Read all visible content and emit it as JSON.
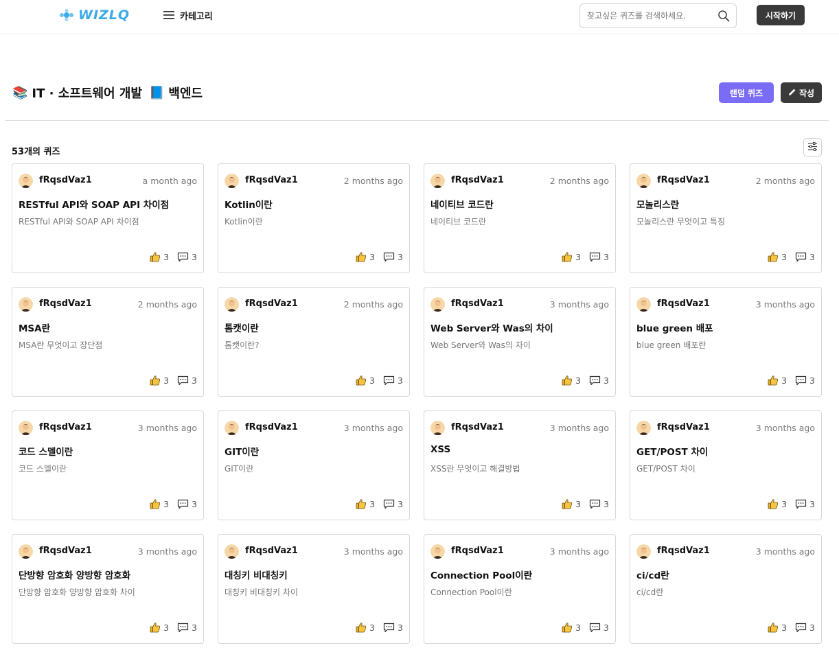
{
  "header": {
    "logo_text": "WIZLQ",
    "category_label": "카테고리",
    "search_placeholder": "찾고싶은 퀴즈를 검색하세요.",
    "start_label": "시작하기"
  },
  "page": {
    "category_emoji": "📚",
    "category": "IT · 소프트웨어 개발",
    "subcategory_emoji": "📘",
    "subcategory": "백엔드",
    "random_label": "랜덤 퀴즈",
    "write_label": "작성",
    "count_label": "53개의 퀴즈"
  },
  "colors": {
    "accent": "#7b6cf6",
    "dark_button": "#3a3a3a",
    "logo": "#3aa9e8"
  },
  "cards": [
    {
      "author": "fRqsdVaz1",
      "time": "a month ago",
      "title": "RESTful API와 SOAP API 차이점",
      "desc": "RESTful API와 SOAP API 차이점",
      "likes": "3",
      "comments": "3"
    },
    {
      "author": "fRqsdVaz1",
      "time": "2 months ago",
      "title": "Kotlin이란",
      "desc": "Kotlin이란",
      "likes": "3",
      "comments": "3"
    },
    {
      "author": "fRqsdVaz1",
      "time": "2 months ago",
      "title": "네이티브 코드란",
      "desc": "네이티브 코드란",
      "likes": "3",
      "comments": "3"
    },
    {
      "author": "fRqsdVaz1",
      "time": "2 months ago",
      "title": "모놀리스란",
      "desc": "모놀리스란 무엇이고 특징",
      "likes": "3",
      "comments": "3"
    },
    {
      "author": "fRqsdVaz1",
      "time": "2 months ago",
      "title": "MSA란",
      "desc": "MSA란 무엇이고 장단점",
      "likes": "3",
      "comments": "3"
    },
    {
      "author": "fRqsdVaz1",
      "time": "2 months ago",
      "title": "톰캣이란",
      "desc": "톰캣이란?",
      "likes": "3",
      "comments": "3"
    },
    {
      "author": "fRqsdVaz1",
      "time": "3 months ago",
      "title": "Web Server와 Was의 차이",
      "desc": "Web Server와 Was의 차이",
      "likes": "3",
      "comments": "3"
    },
    {
      "author": "fRqsdVaz1",
      "time": "3 months ago",
      "title": "blue green 배포",
      "desc": "blue green 배포란",
      "likes": "3",
      "comments": "3"
    },
    {
      "author": "fRqsdVaz1",
      "time": "3 months ago",
      "title": "코드 스멜이란",
      "desc": "코드 스멜이란",
      "likes": "3",
      "comments": "3"
    },
    {
      "author": "fRqsdVaz1",
      "time": "3 months ago",
      "title": "GIT이란",
      "desc": "GIT이란",
      "likes": "3",
      "comments": "3"
    },
    {
      "author": "fRqsdVaz1",
      "time": "3 months ago",
      "title": "XSS",
      "desc": "XSS란 무엇이고 해결방법",
      "likes": "3",
      "comments": "3"
    },
    {
      "author": "fRqsdVaz1",
      "time": "3 months ago",
      "title": "GET/POST 차이",
      "desc": "GET/POST 차이",
      "likes": "3",
      "comments": "3"
    },
    {
      "author": "fRqsdVaz1",
      "time": "3 months ago",
      "title": "단방향 암호화 양방향 암호화",
      "desc": "단방향 암호화 양방향 암호화 차이",
      "likes": "3",
      "comments": "3"
    },
    {
      "author": "fRqsdVaz1",
      "time": "3 months ago",
      "title": "대칭키 비대칭키",
      "desc": "대칭키 비대칭키 차이",
      "likes": "3",
      "comments": "3"
    },
    {
      "author": "fRqsdVaz1",
      "time": "3 months ago",
      "title": "Connection Pool이란",
      "desc": "Connection Pool이란",
      "likes": "3",
      "comments": "3"
    },
    {
      "author": "fRqsdVaz1",
      "time": "3 months ago",
      "title": "ci/cd란",
      "desc": "ci/cd란",
      "likes": "3",
      "comments": "3"
    }
  ]
}
